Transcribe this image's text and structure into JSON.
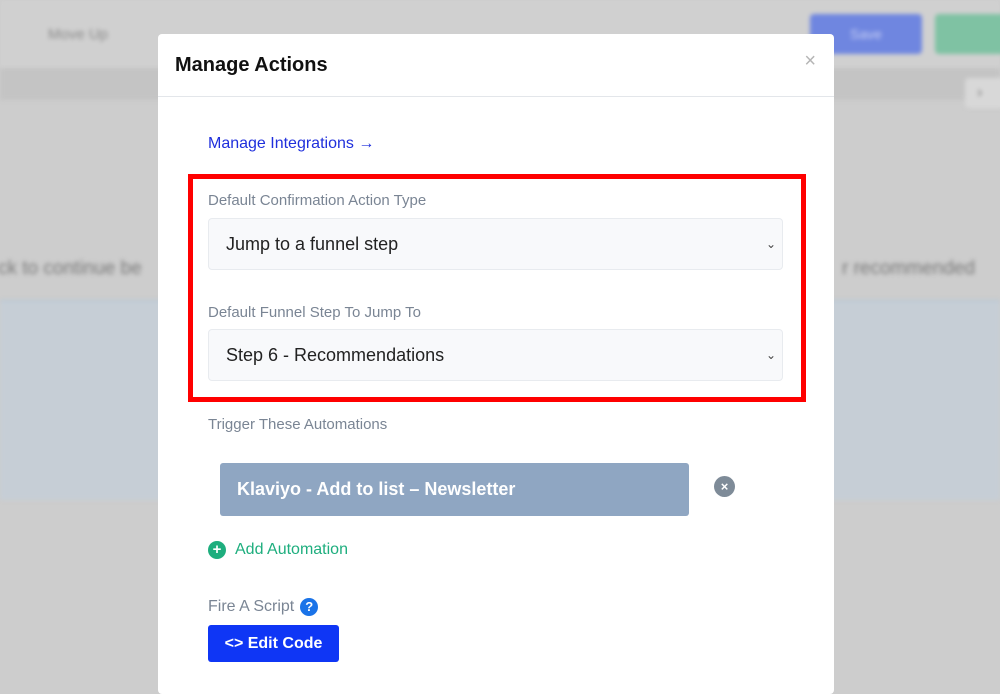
{
  "background": {
    "move_up": "Move Up",
    "save": "Save",
    "left_text": "ck to continue be",
    "right_text": "r recommended"
  },
  "modal": {
    "title": "Manage Actions",
    "close_icon": "close-icon",
    "manage_integrations": "Manage Integrations →",
    "confirmation_label": "Default Confirmation Action Type",
    "confirmation_value": "Jump to a funnel step",
    "funnel_step_label": "Default Funnel Step To Jump To",
    "funnel_step_value": "Step 6 - Recommendations",
    "automations_label": "Trigger These Automations",
    "automations": [
      "Klaviyo - Add to list – Newsletter"
    ],
    "add_automation": "Add Automation",
    "fire_script_label": "Fire A Script",
    "edit_code": "Edit Code",
    "highlight_color": "#ff0000",
    "primary_color": "#0f36f5",
    "success_color": "#1eae7e"
  }
}
